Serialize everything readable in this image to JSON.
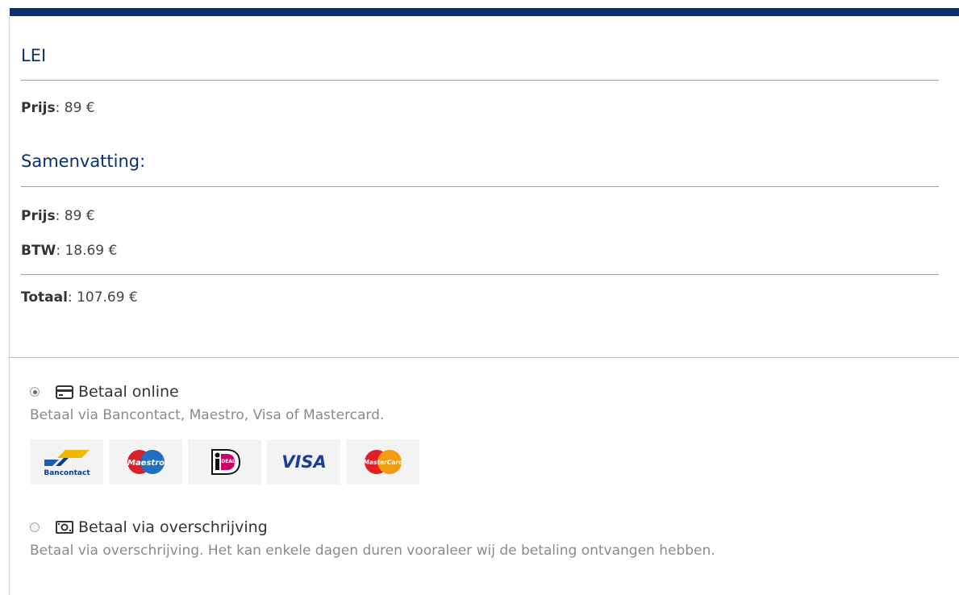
{
  "product": {
    "title": "LEI",
    "price_label": "Prijs",
    "price_value": "89 €"
  },
  "summary": {
    "title": "Samenvatting:",
    "price_label": "Prijs",
    "price_value": "89 €",
    "vat_label": "BTW",
    "vat_value": "18.69 €",
    "total_label": "Totaal",
    "total_value": "107.69 €"
  },
  "payment_options": [
    {
      "label": "Betaal online",
      "description": "Betaal via Bancontact, Maestro, Visa of Mastercard.",
      "selected": true,
      "icon": "credit-card-icon"
    },
    {
      "label": "Betaal via overschrijving",
      "description": "Betaal via overschrijving. Het kan enkele dagen duren vooraleer wij de betaling ontvangen hebben.",
      "selected": false,
      "icon": "banknote-icon"
    }
  ],
  "payment_logos": [
    {
      "name": "Bancontact",
      "text": "Bancontact"
    },
    {
      "name": "Maestro",
      "text": "Maestro"
    },
    {
      "name": "iDEAL",
      "text": "iDEAL"
    },
    {
      "name": "Visa",
      "text": "VISA"
    },
    {
      "name": "Mastercard",
      "text": "MasterCard"
    }
  ],
  "colors": {
    "brand": "#0d2f6b",
    "rule": "#9e9e9e",
    "muted_text": "#8a8a8a"
  }
}
